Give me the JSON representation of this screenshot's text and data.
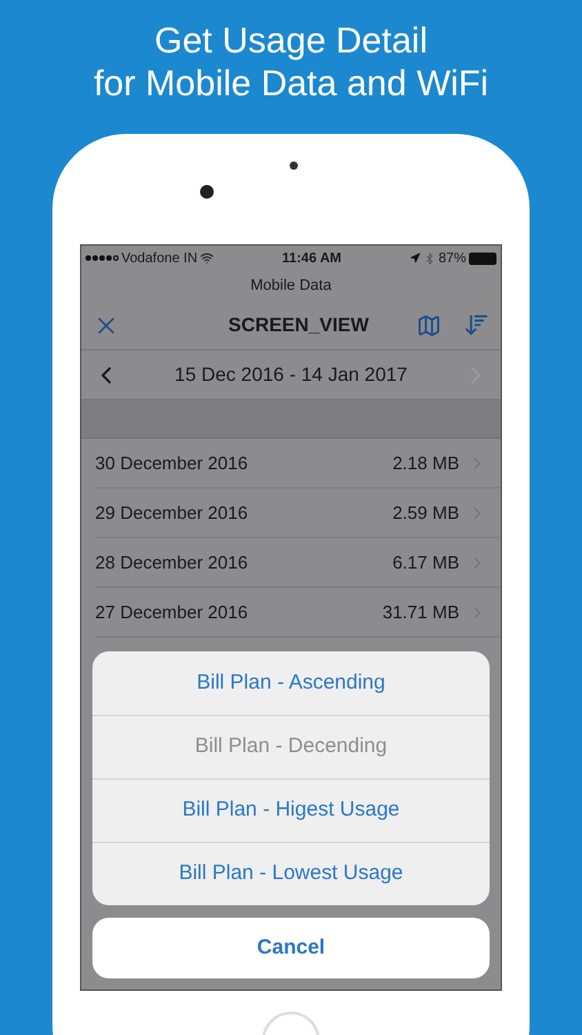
{
  "headline": [
    "Get Usage Detail",
    "for Mobile Data and WiFi"
  ],
  "status_bar": {
    "carrier": "Vodafone IN",
    "time": "11:46 AM",
    "battery": "87%"
  },
  "nav": {
    "subtitle": "Mobile Data",
    "title": "SCREEN_VIEW"
  },
  "period": {
    "label": "15 Dec 2016 - 14 Jan 2017",
    "next_disabled": true
  },
  "rows": [
    {
      "date": "30 December 2016",
      "usage": "2.18 MB"
    },
    {
      "date": "29 December 2016",
      "usage": "2.59 MB"
    },
    {
      "date": "28 December 2016",
      "usage": "6.17 MB"
    },
    {
      "date": "27 December 2016",
      "usage": "31.71 MB"
    }
  ],
  "sort_sheet": {
    "options": [
      {
        "label": "Bill Plan - Ascending",
        "disabled": false
      },
      {
        "label": "Bill Plan - Decending",
        "disabled": true
      },
      {
        "label": "Bill Plan - Higest Usage",
        "disabled": false
      },
      {
        "label": "Bill Plan - Lowest Usage",
        "disabled": false
      }
    ],
    "cancel": "Cancel"
  }
}
